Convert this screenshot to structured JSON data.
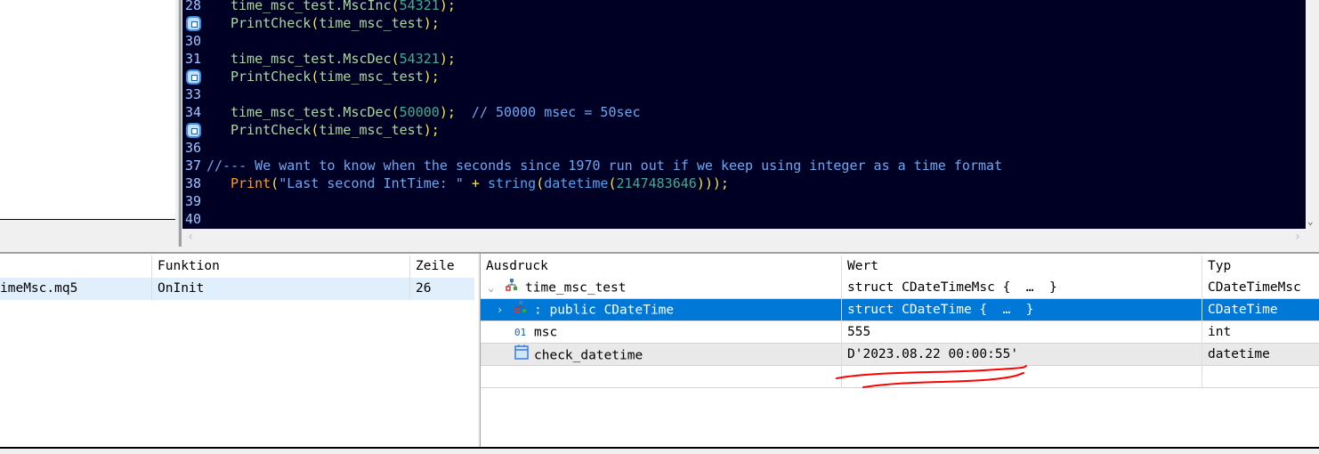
{
  "editor": {
    "lines": [
      {
        "num": "28",
        "bp": false,
        "tokens": [
          [
            "id",
            "time_msc_test.MscInc"
          ],
          [
            "pn",
            "("
          ],
          [
            "nm",
            "54321"
          ],
          [
            "pn",
            ");"
          ]
        ]
      },
      {
        "num": "29",
        "bp": true,
        "tokens": [
          [
            "fn",
            "PrintCheck"
          ],
          [
            "pn",
            "("
          ],
          [
            "id",
            "time_msc_test"
          ],
          [
            "pn",
            ");"
          ]
        ]
      },
      {
        "num": "30",
        "bp": false,
        "tokens": []
      },
      {
        "num": "31",
        "bp": false,
        "tokens": [
          [
            "id",
            "time_msc_test.MscDec"
          ],
          [
            "pn",
            "("
          ],
          [
            "nm",
            "54321"
          ],
          [
            "pn",
            ");"
          ]
        ]
      },
      {
        "num": "32",
        "bp": true,
        "tokens": [
          [
            "fn",
            "PrintCheck"
          ],
          [
            "pn",
            "("
          ],
          [
            "id",
            "time_msc_test"
          ],
          [
            "pn",
            ");"
          ]
        ]
      },
      {
        "num": "33",
        "bp": false,
        "tokens": []
      },
      {
        "num": "34",
        "bp": false,
        "tokens": [
          [
            "id",
            "time_msc_test.MscDec"
          ],
          [
            "pn",
            "("
          ],
          [
            "nm",
            "50000"
          ],
          [
            "pn",
            ");"
          ],
          [
            "cm",
            "  // 50000 msec = 50sec"
          ]
        ]
      },
      {
        "num": "35",
        "bp": true,
        "tokens": [
          [
            "fn",
            "PrintCheck"
          ],
          [
            "pn",
            "("
          ],
          [
            "id",
            "time_msc_test"
          ],
          [
            "pn",
            ");"
          ]
        ]
      },
      {
        "num": "36",
        "bp": false,
        "tokens": []
      },
      {
        "num": "37",
        "bp": false,
        "comment": true,
        "tokens": [
          [
            "cm",
            "//--- We want to know when the seconds since 1970 run out if we keep using integer as a time format"
          ]
        ]
      },
      {
        "num": "38",
        "bp": false,
        "tokens": [
          [
            "kw",
            "Print"
          ],
          [
            "pn",
            "("
          ],
          [
            "st",
            "\"Last second IntTime: \""
          ],
          [
            "pn",
            " + "
          ],
          [
            "ty",
            "string"
          ],
          [
            "pn",
            "("
          ],
          [
            "ty",
            "datetime"
          ],
          [
            "pn",
            "("
          ],
          [
            "nm",
            "2147483646"
          ],
          [
            "pn",
            ")));"
          ]
        ]
      },
      {
        "num": "39",
        "bp": false,
        "tokens": []
      },
      {
        "num": "40",
        "bp": false,
        "tokens": []
      }
    ]
  },
  "callstack": {
    "headers": [
      "",
      "Funktion",
      "Zeile"
    ],
    "rows": [
      [
        "imeMsc.mq5",
        "OnInit",
        "26"
      ]
    ]
  },
  "watch": {
    "headers": [
      "Ausdruck",
      "Wert",
      "Typ"
    ],
    "rows": [
      {
        "expr": "time_msc_test",
        "value": "struct CDateTimeMsc {  …  }",
        "type": "CDateTimeMsc",
        "icon": "struct-icon",
        "expander": "expanded",
        "indent": 0
      },
      {
        "expr": ": public CDateTime",
        "value": "struct CDateTime {  …  }",
        "type": "CDateTime",
        "icon": "struct-icon",
        "expander": "collapsed",
        "indent": 1,
        "selected": true
      },
      {
        "expr": "msc",
        "value": "555",
        "type": "int",
        "icon": "int-icon",
        "indent": 1
      },
      {
        "expr": "check_datetime",
        "value": "D'2023.08.22 00:00:55'",
        "type": "datetime",
        "icon": "calendar-icon",
        "indent": 1,
        "gray": true
      }
    ]
  },
  "colors": {
    "editor_bg": "#000025",
    "selection": "#0078d7",
    "annotation": "#ff0000"
  }
}
